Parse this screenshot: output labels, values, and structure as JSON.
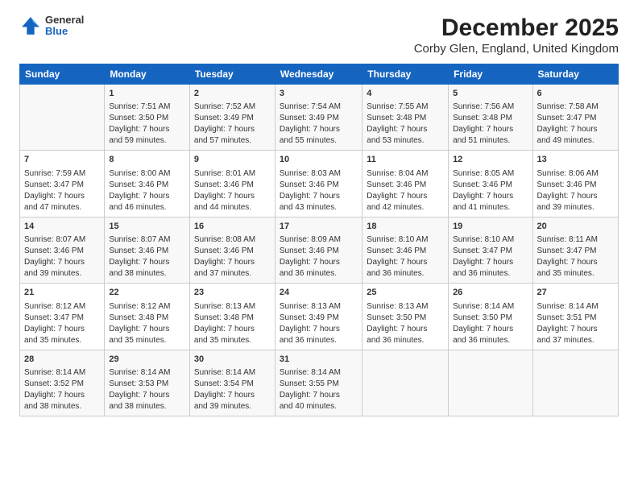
{
  "header": {
    "logo": {
      "general": "General",
      "blue": "Blue"
    },
    "title": "December 2025",
    "location": "Corby Glen, England, United Kingdom"
  },
  "calendar": {
    "days": [
      "Sunday",
      "Monday",
      "Tuesday",
      "Wednesday",
      "Thursday",
      "Friday",
      "Saturday"
    ],
    "weeks": [
      [
        {
          "day": "",
          "content": ""
        },
        {
          "day": "1",
          "content": "Sunrise: 7:51 AM\nSunset: 3:50 PM\nDaylight: 7 hours\nand 59 minutes."
        },
        {
          "day": "2",
          "content": "Sunrise: 7:52 AM\nSunset: 3:49 PM\nDaylight: 7 hours\nand 57 minutes."
        },
        {
          "day": "3",
          "content": "Sunrise: 7:54 AM\nSunset: 3:49 PM\nDaylight: 7 hours\nand 55 minutes."
        },
        {
          "day": "4",
          "content": "Sunrise: 7:55 AM\nSunset: 3:48 PM\nDaylight: 7 hours\nand 53 minutes."
        },
        {
          "day": "5",
          "content": "Sunrise: 7:56 AM\nSunset: 3:48 PM\nDaylight: 7 hours\nand 51 minutes."
        },
        {
          "day": "6",
          "content": "Sunrise: 7:58 AM\nSunset: 3:47 PM\nDaylight: 7 hours\nand 49 minutes."
        }
      ],
      [
        {
          "day": "7",
          "content": "Sunrise: 7:59 AM\nSunset: 3:47 PM\nDaylight: 7 hours\nand 47 minutes."
        },
        {
          "day": "8",
          "content": "Sunrise: 8:00 AM\nSunset: 3:46 PM\nDaylight: 7 hours\nand 46 minutes."
        },
        {
          "day": "9",
          "content": "Sunrise: 8:01 AM\nSunset: 3:46 PM\nDaylight: 7 hours\nand 44 minutes."
        },
        {
          "day": "10",
          "content": "Sunrise: 8:03 AM\nSunset: 3:46 PM\nDaylight: 7 hours\nand 43 minutes."
        },
        {
          "day": "11",
          "content": "Sunrise: 8:04 AM\nSunset: 3:46 PM\nDaylight: 7 hours\nand 42 minutes."
        },
        {
          "day": "12",
          "content": "Sunrise: 8:05 AM\nSunset: 3:46 PM\nDaylight: 7 hours\nand 41 minutes."
        },
        {
          "day": "13",
          "content": "Sunrise: 8:06 AM\nSunset: 3:46 PM\nDaylight: 7 hours\nand 39 minutes."
        }
      ],
      [
        {
          "day": "14",
          "content": "Sunrise: 8:07 AM\nSunset: 3:46 PM\nDaylight: 7 hours\nand 39 minutes."
        },
        {
          "day": "15",
          "content": "Sunrise: 8:07 AM\nSunset: 3:46 PM\nDaylight: 7 hours\nand 38 minutes."
        },
        {
          "day": "16",
          "content": "Sunrise: 8:08 AM\nSunset: 3:46 PM\nDaylight: 7 hours\nand 37 minutes."
        },
        {
          "day": "17",
          "content": "Sunrise: 8:09 AM\nSunset: 3:46 PM\nDaylight: 7 hours\nand 36 minutes."
        },
        {
          "day": "18",
          "content": "Sunrise: 8:10 AM\nSunset: 3:46 PM\nDaylight: 7 hours\nand 36 minutes."
        },
        {
          "day": "19",
          "content": "Sunrise: 8:10 AM\nSunset: 3:47 PM\nDaylight: 7 hours\nand 36 minutes."
        },
        {
          "day": "20",
          "content": "Sunrise: 8:11 AM\nSunset: 3:47 PM\nDaylight: 7 hours\nand 35 minutes."
        }
      ],
      [
        {
          "day": "21",
          "content": "Sunrise: 8:12 AM\nSunset: 3:47 PM\nDaylight: 7 hours\nand 35 minutes."
        },
        {
          "day": "22",
          "content": "Sunrise: 8:12 AM\nSunset: 3:48 PM\nDaylight: 7 hours\nand 35 minutes."
        },
        {
          "day": "23",
          "content": "Sunrise: 8:13 AM\nSunset: 3:48 PM\nDaylight: 7 hours\nand 35 minutes."
        },
        {
          "day": "24",
          "content": "Sunrise: 8:13 AM\nSunset: 3:49 PM\nDaylight: 7 hours\nand 36 minutes."
        },
        {
          "day": "25",
          "content": "Sunrise: 8:13 AM\nSunset: 3:50 PM\nDaylight: 7 hours\nand 36 minutes."
        },
        {
          "day": "26",
          "content": "Sunrise: 8:14 AM\nSunset: 3:50 PM\nDaylight: 7 hours\nand 36 minutes."
        },
        {
          "day": "27",
          "content": "Sunrise: 8:14 AM\nSunset: 3:51 PM\nDaylight: 7 hours\nand 37 minutes."
        }
      ],
      [
        {
          "day": "28",
          "content": "Sunrise: 8:14 AM\nSunset: 3:52 PM\nDaylight: 7 hours\nand 38 minutes."
        },
        {
          "day": "29",
          "content": "Sunrise: 8:14 AM\nSunset: 3:53 PM\nDaylight: 7 hours\nand 38 minutes."
        },
        {
          "day": "30",
          "content": "Sunrise: 8:14 AM\nSunset: 3:54 PM\nDaylight: 7 hours\nand 39 minutes."
        },
        {
          "day": "31",
          "content": "Sunrise: 8:14 AM\nSunset: 3:55 PM\nDaylight: 7 hours\nand 40 minutes."
        },
        {
          "day": "",
          "content": ""
        },
        {
          "day": "",
          "content": ""
        },
        {
          "day": "",
          "content": ""
        }
      ]
    ]
  }
}
